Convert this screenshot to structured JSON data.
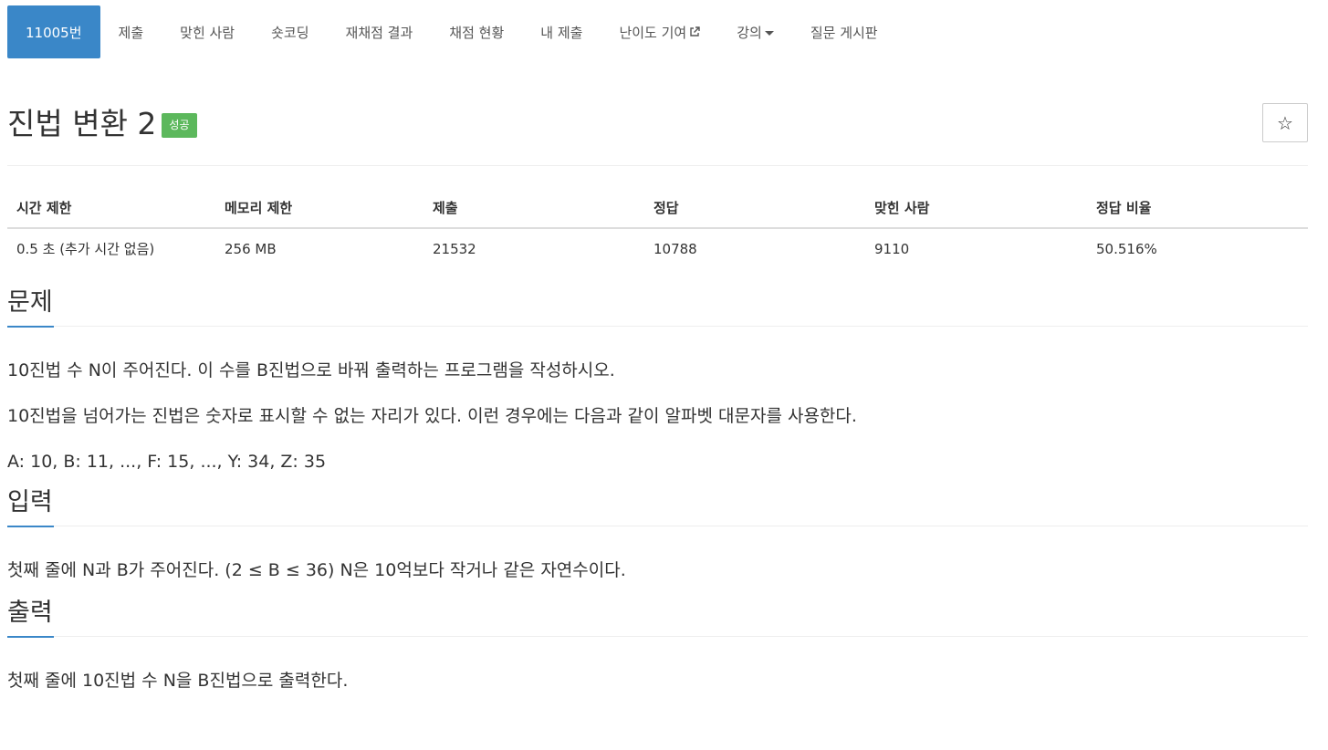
{
  "nav": {
    "tabs": [
      {
        "label": "11005번",
        "active": true
      },
      {
        "label": "제출",
        "active": false
      },
      {
        "label": "맞힌 사람",
        "active": false
      },
      {
        "label": "숏코딩",
        "active": false
      },
      {
        "label": "재채점 결과",
        "active": false
      },
      {
        "label": "채점 현황",
        "active": false
      },
      {
        "label": "내 제출",
        "active": false
      },
      {
        "label": "난이도 기여",
        "active": false,
        "icon": "external-link-icon"
      },
      {
        "label": "강의",
        "active": false,
        "icon": "caret-down-icon"
      },
      {
        "label": "질문 게시판",
        "active": false
      }
    ]
  },
  "problem": {
    "title": "진법 변환 2",
    "status_badge": "성공",
    "star_icon": "star-outline-icon"
  },
  "info_table": {
    "headers": [
      "시간 제한",
      "메모리 제한",
      "제출",
      "정답",
      "맞힌 사람",
      "정답 비율"
    ],
    "row": [
      "0.5 초 (추가 시간 없음)",
      "256 MB",
      "21532",
      "10788",
      "9110",
      "50.516%"
    ]
  },
  "sections": {
    "description": {
      "heading": "문제",
      "paragraphs": [
        "10진법 수 N이 주어진다. 이 수를 B진법으로 바꿔 출력하는 프로그램을 작성하시오.",
        "10진법을 넘어가는 진법은 숫자로 표시할 수 없는 자리가 있다. 이런 경우에는 다음과 같이 알파벳 대문자를 사용한다.",
        "A: 10, B: 11, ..., F: 15, ..., Y: 34, Z: 35"
      ]
    },
    "input": {
      "heading": "입력",
      "paragraphs": [
        "첫째 줄에 N과 B가 주어진다. (2 ≤ B ≤ 36) N은 10억보다 작거나 같은 자연수이다."
      ]
    },
    "output": {
      "heading": "출력",
      "paragraphs": [
        "첫째 줄에 10진법 수 N을 B진법으로 출력한다."
      ]
    }
  },
  "colors": {
    "accent": "#3a87c8",
    "success": "#5cb85c"
  }
}
